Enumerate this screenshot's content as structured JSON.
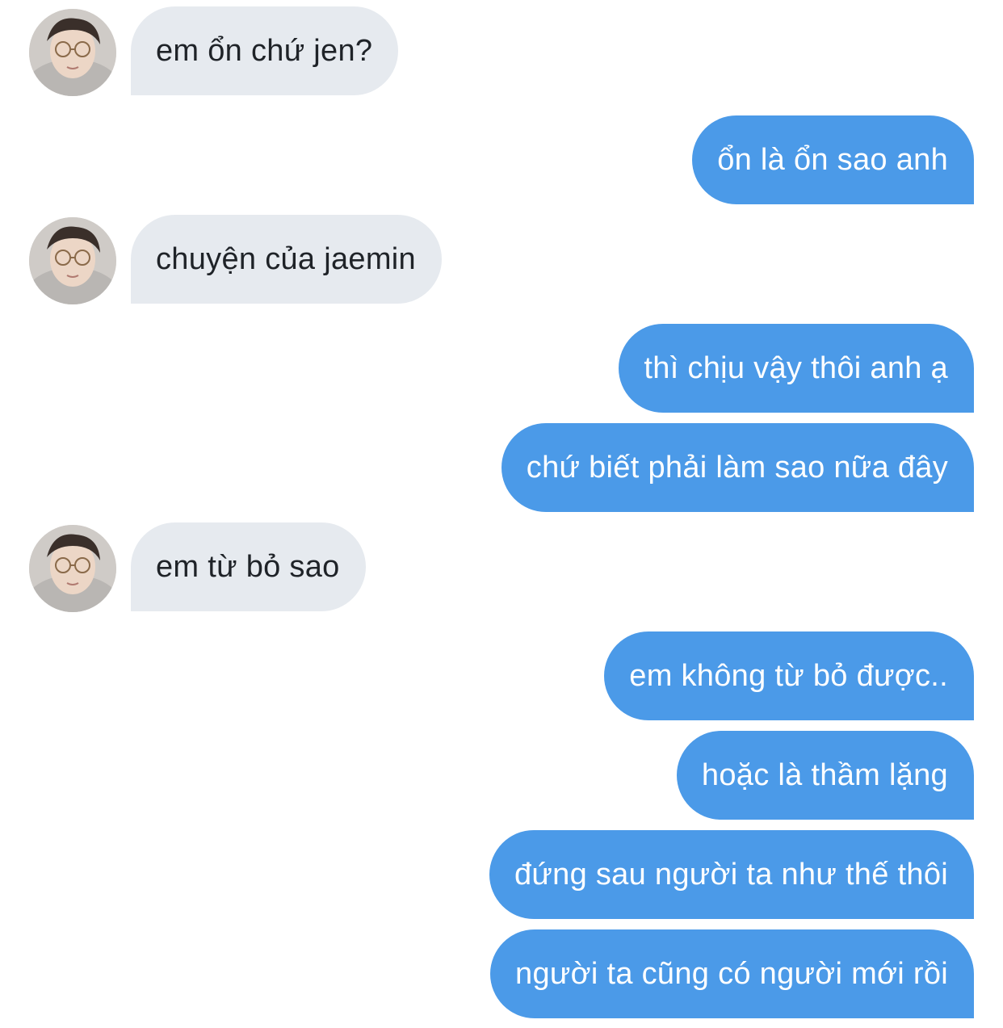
{
  "conversation": {
    "contact_avatar_icon": "contact-avatar-photo",
    "colors": {
      "incoming_bubble": "#e6eaef",
      "incoming_text": "#1f2328",
      "outgoing_bubble": "#4b9ae8",
      "outgoing_text": "#ffffff"
    },
    "messages": [
      {
        "direction": "in",
        "text": "em ổn chứ jen?"
      },
      {
        "direction": "out",
        "text": "ổn là ổn sao anh"
      },
      {
        "direction": "in",
        "text": "chuyện của jaemin"
      },
      {
        "direction": "out",
        "text": "thì chịu vậy thôi anh ạ"
      },
      {
        "direction": "out",
        "text": "chứ biết phải làm sao nữa đây"
      },
      {
        "direction": "in",
        "text": "em từ bỏ sao"
      },
      {
        "direction": "out",
        "text": "em không từ bỏ được.."
      },
      {
        "direction": "out",
        "text": "hoặc là thầm lặng"
      },
      {
        "direction": "out",
        "text": "đứng sau người ta như thế thôi"
      },
      {
        "direction": "out",
        "text": "người ta cũng có người mới rồi"
      }
    ]
  }
}
